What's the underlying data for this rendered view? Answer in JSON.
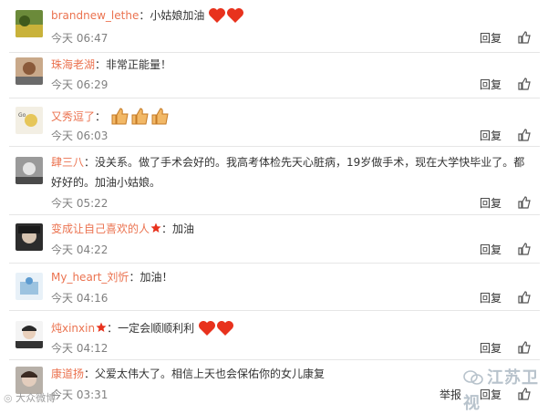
{
  "comments": [
    {
      "user": "brandnew_lethe",
      "sep": "：",
      "text": "小姑娘加油",
      "time": "今天 06:47",
      "hearts": 2
    },
    {
      "user": "珠海老湖",
      "sep": "：",
      "text": "非常正能量！",
      "time": "今天 06:29"
    },
    {
      "user": "又秀逗了",
      "sep": "：",
      "text": "",
      "time": "今天 06:03",
      "thumbs": 3
    },
    {
      "user": "肆三八",
      "sep": "：",
      "text": "没关系。做了手术会好的。我高考体检先天心脏病，19岁做手术，现在大学快毕业了。都",
      "text2": "好好的。加油小姑娘。",
      "time": "今天 05:22"
    },
    {
      "user": "变成让自己喜欢的人",
      "sep": "：",
      "text": "加油",
      "time": "今天 04:22",
      "vip": true
    },
    {
      "user": "My_heart_刘忻",
      "sep": "：",
      "text": "加油！",
      "time": "今天 04:16"
    },
    {
      "user": "炖xinxin",
      "sep": "：",
      "text": "一定会顺顺利利",
      "time": "今天 04:12",
      "vip": true,
      "hearts": 2
    },
    {
      "user": "康道扬",
      "sep": "：",
      "text": "父爱太伟大了。相信上天也会保佑你的女儿康复",
      "time": "今天 03:31"
    }
  ],
  "actions": {
    "reply": "回复",
    "report": "举报"
  },
  "watermark": {
    "left": "大众微博",
    "right": "江苏卫视"
  },
  "colors": {
    "username": "#eb7350",
    "time": "#808080",
    "heart": "#e8321d",
    "vip": "#e8321d"
  }
}
